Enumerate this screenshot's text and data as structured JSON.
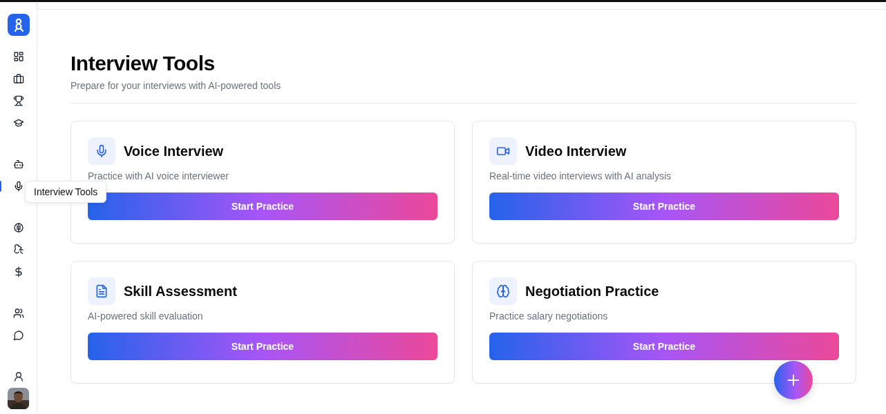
{
  "sidebar": {
    "groups": [
      {
        "items": [
          {
            "selected": false
          },
          {
            "selected": false
          },
          {
            "selected": false
          },
          {
            "selected": false
          }
        ]
      },
      {
        "items": [
          {
            "selected": false
          },
          {
            "selected": true
          }
        ]
      },
      {
        "items": [
          {
            "selected": false
          },
          {
            "selected": false
          },
          {
            "selected": false
          }
        ]
      },
      {
        "items": [
          {
            "selected": false
          },
          {
            "selected": false
          }
        ]
      },
      {
        "items": [
          {
            "selected": false
          }
        ]
      }
    ]
  },
  "tooltip": "Interview Tools",
  "page": {
    "title": "Interview Tools",
    "subtitle": "Prepare for your interviews with AI-powered tools"
  },
  "cards": [
    {
      "title": "Voice Interview",
      "description": "Practice with AI voice interviewer",
      "button": "Start Practice"
    },
    {
      "title": "Video Interview",
      "description": "Real-time video interviews with AI analysis",
      "button": "Start Practice"
    },
    {
      "title": "Skill Assessment",
      "description": "AI-powered skill evaluation",
      "button": "Start Practice"
    },
    {
      "title": "Negotiation Practice",
      "description": "Practice salary negotiations",
      "button": "Start Practice"
    }
  ]
}
